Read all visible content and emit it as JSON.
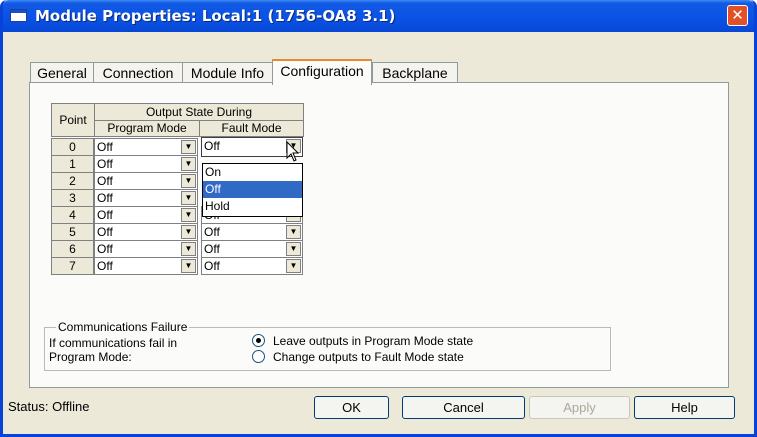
{
  "window": {
    "title": "Module Properties: Local:1 (1756-OA8 3.1)",
    "close_glyph": "✕"
  },
  "tabs": [
    {
      "label": "General"
    },
    {
      "label": "Connection"
    },
    {
      "label": "Module Info"
    },
    {
      "label": "Configuration"
    },
    {
      "label": "Backplane"
    }
  ],
  "active_tab": "Configuration",
  "table": {
    "point_header": "Point",
    "group_header": "Output State During",
    "program_header": "Program Mode",
    "fault_header": "Fault Mode",
    "rows": [
      {
        "point": "0",
        "program": "Off",
        "fault": "Off"
      },
      {
        "point": "1",
        "program": "Off",
        "fault": ""
      },
      {
        "point": "2",
        "program": "Off",
        "fault": ""
      },
      {
        "point": "3",
        "program": "Off",
        "fault": ""
      },
      {
        "point": "4",
        "program": "Off",
        "fault": "Off"
      },
      {
        "point": "5",
        "program": "Off",
        "fault": "Off"
      },
      {
        "point": "6",
        "program": "Off",
        "fault": "Off"
      },
      {
        "point": "7",
        "program": "Off",
        "fault": "Off"
      }
    ]
  },
  "dropdown": {
    "options": [
      "On",
      "Off",
      "Hold"
    ],
    "selected": "Off"
  },
  "comm_failure": {
    "title": "Communications Failure",
    "desc_line1": "If communications fail in",
    "desc_line2": "Program Mode:",
    "option1": "Leave outputs in Program Mode state",
    "option2": "Change outputs to Fault Mode state",
    "selected_option": 1
  },
  "status": {
    "label": "Status:",
    "value": "Offline"
  },
  "buttons": {
    "ok": "OK",
    "cancel": "Cancel",
    "apply": "Apply",
    "help": "Help"
  },
  "icons": {
    "combo_arrow": "chevron-down-icon",
    "cursor": "mouse-pointer-icon"
  }
}
